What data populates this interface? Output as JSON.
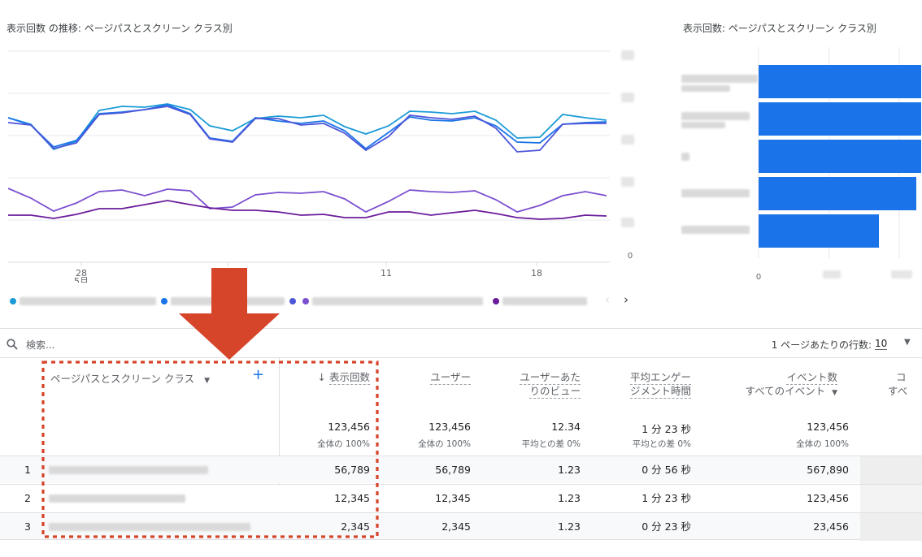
{
  "line_chart": {
    "title": "表示回数 の推移: ページパスとスクリーン クラス別",
    "x_ticks": [
      {
        "day": "28",
        "month": "5月"
      },
      {
        "day": "11",
        "month": ""
      },
      {
        "day": "18",
        "month": ""
      }
    ],
    "y_tick_zero": "0",
    "series_colors": [
      "#1a9bd7",
      "#1a73e8",
      "#4d56d9",
      "#7b4fcf",
      "#6a1b9a"
    ]
  },
  "bar_chart": {
    "title": "表示回数: ページパスとスクリーン クラス別",
    "x_tick_zero": "0",
    "bar_color": "#1a73e8",
    "values": [
      1.0,
      1.0,
      1.0,
      0.97,
      0.74
    ]
  },
  "legend": {
    "next_icon": "›",
    "prev_icon": "‹"
  },
  "toolbar": {
    "search_placeholder": "検索...",
    "rows_per_page_label": "1 ページあたりの行数:",
    "rows_per_page_value": "10"
  },
  "table": {
    "dimension_header": "ページパスとスクリーン クラス",
    "add_icon": "+",
    "columns": [
      {
        "line1": "表示回数",
        "line2": "",
        "sorted": true,
        "total": "123,456",
        "sub": "全体の 100%"
      },
      {
        "line1": "ユーザー",
        "line2": "",
        "total": "123,456",
        "sub": "全体の 100%"
      },
      {
        "line1": "ユーザーあた",
        "line2": "りのビュー",
        "total": "12.34",
        "sub": "平均との差 0%"
      },
      {
        "line1": "平均エンゲー",
        "line2": "ジメント時間",
        "total": "1 分 23 秒",
        "sub": "平均との差 0%"
      },
      {
        "line1": "イベント数",
        "line2": "すべてのイベント",
        "total": "123,456",
        "sub": "全体の 100%"
      },
      {
        "line1": "コ",
        "line2": "すべ",
        "total": "",
        "sub": ""
      }
    ],
    "rows": [
      {
        "num": "1",
        "cells": [
          "56,789",
          "56,789",
          "1.23",
          "0 分 56 秒",
          "567,890"
        ]
      },
      {
        "num": "2",
        "cells": [
          "12,345",
          "12,345",
          "1.23",
          "1 分 23 秒",
          "123,456"
        ]
      },
      {
        "num": "3",
        "cells": [
          "2,345",
          "2,345",
          "1.23",
          "0 分 23 秒",
          "23,456"
        ]
      }
    ]
  },
  "annotation": {
    "arrow_color": "#d6442a",
    "box_color": "#d6442a"
  }
}
